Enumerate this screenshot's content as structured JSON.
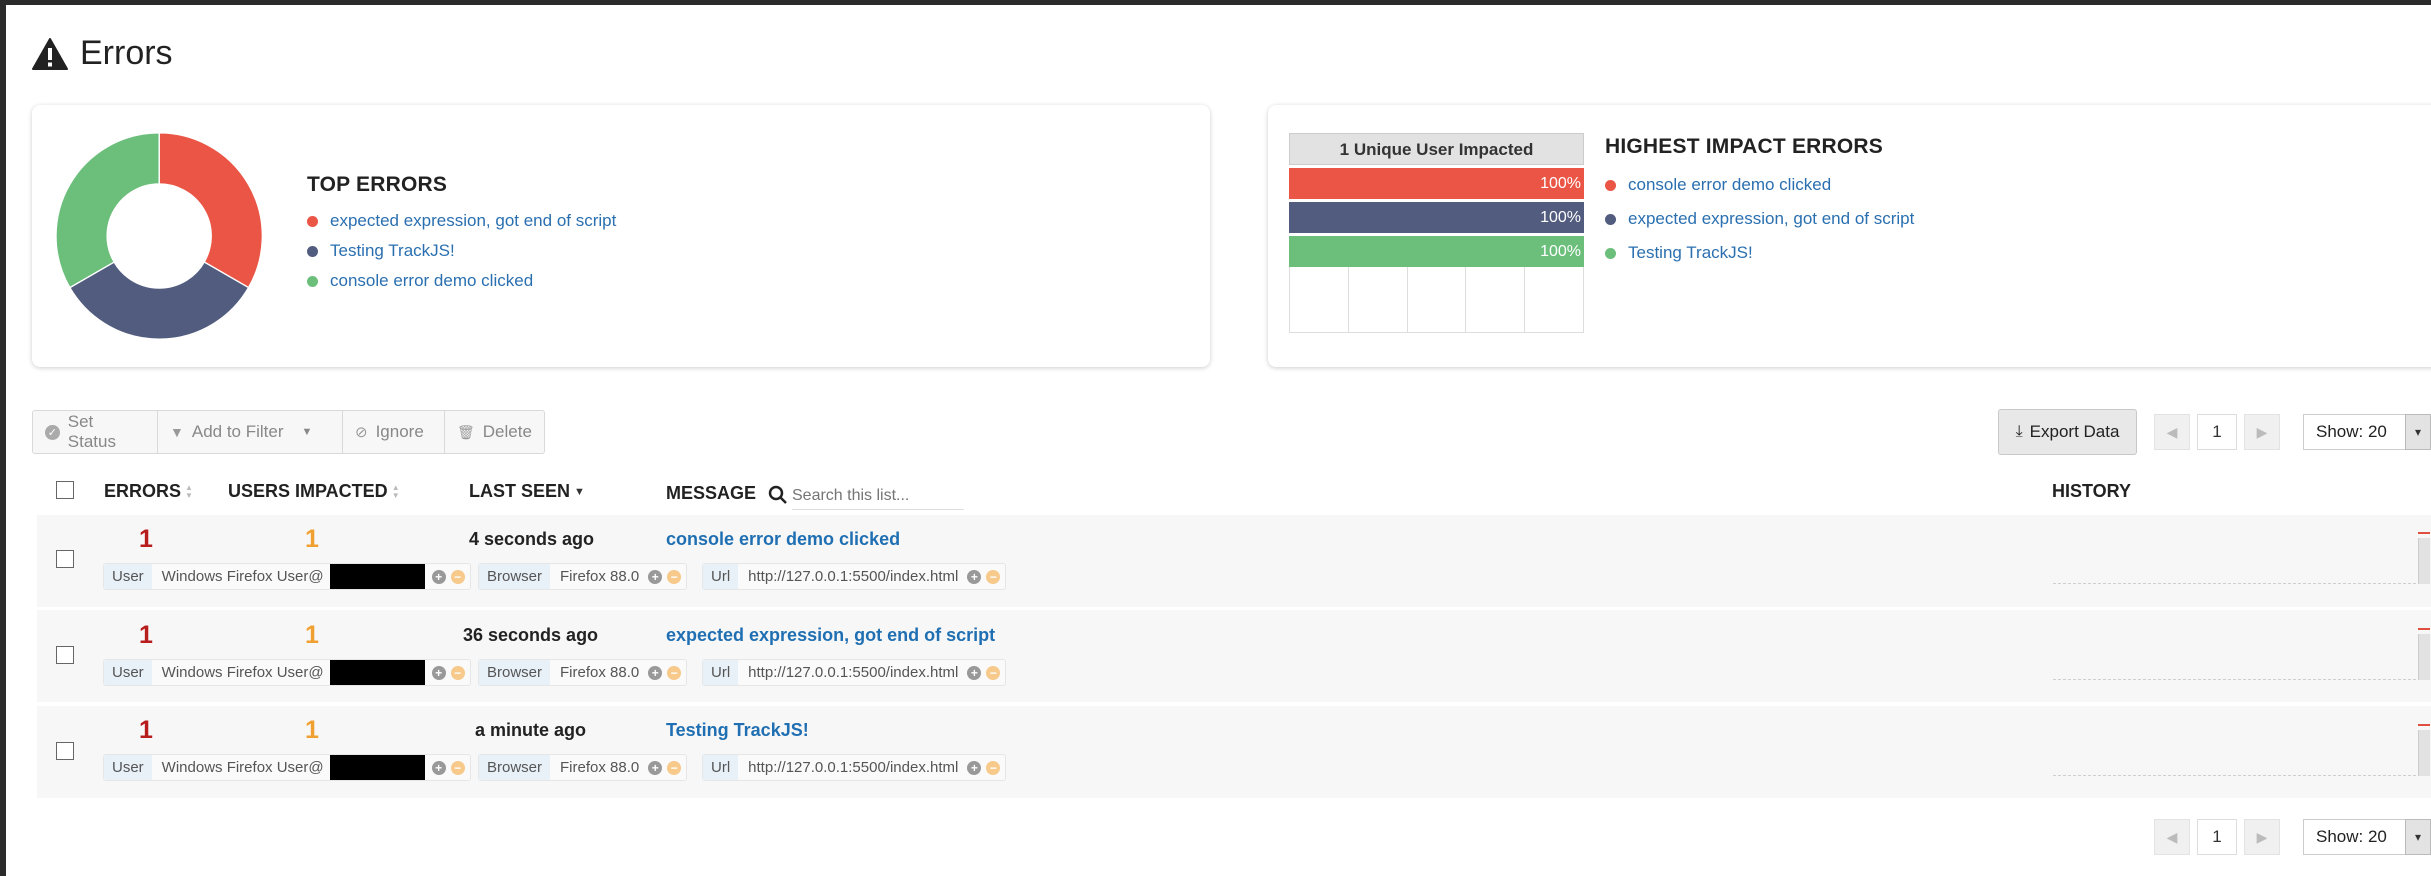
{
  "page": {
    "title": "Errors"
  },
  "top_errors": {
    "title": "TOP ERRORS",
    "items": [
      {
        "label": "expected expression, got end of script",
        "color": "#ea5545",
        "share": 33.33
      },
      {
        "label": "Testing TrackJS!",
        "color": "#515c7e",
        "share": 33.33
      },
      {
        "label": "console error demo clicked",
        "color": "#6bbf7b",
        "share": 33.34
      }
    ]
  },
  "impact": {
    "chart_header": "1 Unique User Impacted",
    "title": "HIGHEST IMPACT ERRORS",
    "bars": [
      {
        "label": "console error demo clicked",
        "value": "100%",
        "pct": 100,
        "color": "#ea5545"
      },
      {
        "label": "expected expression, got end of script",
        "value": "100%",
        "pct": 100,
        "color": "#515c7e"
      },
      {
        "label": "Testing TrackJS!",
        "value": "100%",
        "pct": 100,
        "color": "#6bbf7b"
      }
    ]
  },
  "toolbar": {
    "set_status": "Set Status",
    "add_to_filter": "Add to Filter",
    "ignore": "Ignore",
    "delete": "Delete",
    "export": "Export Data",
    "page": "1",
    "show": "Show: 20"
  },
  "table": {
    "headers": {
      "errors": "ERRORS",
      "users": "USERS IMPACTED",
      "last_seen": "LAST SEEN",
      "message": "MESSAGE",
      "history": "HISTORY"
    },
    "search_placeholder": "Search this list...",
    "rows": [
      {
        "errors": "1",
        "users": "1",
        "last_seen": "4 seconds ago",
        "message": "console error demo clicked",
        "user_key": "User",
        "user_val": "Windows Firefox User@",
        "browser_key": "Browser",
        "browser_val": "Firefox 88.0",
        "url_key": "Url",
        "url_val": "http://127.0.0.1:5500/index.html"
      },
      {
        "errors": "1",
        "users": "1",
        "last_seen": "36 seconds ago",
        "message": "expected expression, got end of script",
        "user_key": "User",
        "user_val": "Windows Firefox User@",
        "browser_key": "Browser",
        "browser_val": "Firefox 88.0",
        "url_key": "Url",
        "url_val": "http://127.0.0.1:5500/index.html"
      },
      {
        "errors": "1",
        "users": "1",
        "last_seen": "a minute ago",
        "message": "Testing TrackJS!",
        "user_key": "User",
        "user_val": "Windows Firefox User@",
        "browser_key": "Browser",
        "browser_val": "Firefox 88.0",
        "url_key": "Url",
        "url_val": "http://127.0.0.1:5500/index.html"
      }
    ]
  },
  "bottom_pager": {
    "page": "1",
    "show": "Show: 20"
  }
}
